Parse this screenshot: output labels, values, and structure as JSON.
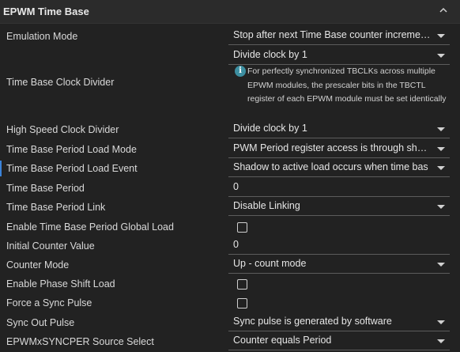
{
  "section": {
    "title": "EPWM Time Base",
    "collapse_icon": "chevron-up-icon"
  },
  "rows": {
    "emulation_mode": {
      "label": "Emulation Mode",
      "value": "Stop after next Time Base counter increment or decrement"
    },
    "clock_divider": {
      "label": "Time Base Clock Divider",
      "value": "Divide clock by 1",
      "info_icon": "info-icon",
      "info": "For perfectly synchronized TBCLKs across multiple EPWM modules, the prescaler bits in the TBCTL register of each EPWM module must be set identically"
    },
    "hs_clock_divider": {
      "label": "High Speed Clock Divider",
      "value": "Divide clock by 1"
    },
    "period_load_mode": {
      "label": "Time Base Period Load Mode",
      "value": "PWM Period register access is through shadow register"
    },
    "period_load_event": {
      "label": "Time Base Period Load Event",
      "value": "Shadow to active load occurs when time bas"
    },
    "period": {
      "label": "Time Base Period",
      "value": "0"
    },
    "period_link": {
      "label": "Time Base Period Link",
      "value": "Disable Linking"
    },
    "global_load": {
      "label": "Enable Time Base Period Global Load",
      "checked": false
    },
    "initial_counter": {
      "label": "Initial Counter Value",
      "value": "0"
    },
    "counter_mode": {
      "label": "Counter Mode",
      "value": "Up - count mode"
    },
    "phase_shift": {
      "label": "Enable Phase Shift Load",
      "checked": false
    },
    "sync_pulse": {
      "label": "Force a Sync Pulse",
      "checked": false
    },
    "sync_out": {
      "label": "Sync Out Pulse",
      "value": "Sync pulse is generated by software"
    },
    "syncper_source": {
      "label": "EPWMxSYNCPER Source Select",
      "value": "Counter equals Period"
    }
  },
  "colors": {
    "background": "#222222",
    "header": "#2b2b2b",
    "active_marker": "#3b83d9",
    "info_icon": "#3d8fa1"
  }
}
